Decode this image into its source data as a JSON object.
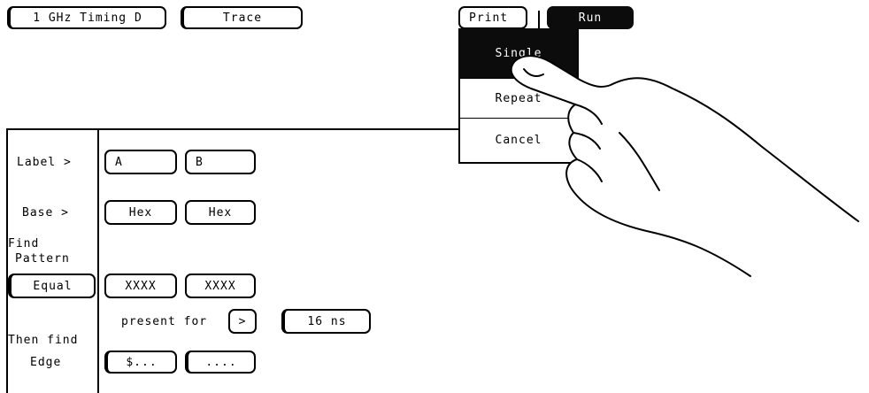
{
  "header": {
    "analyzer_menu": "1 GHz Timing D",
    "mode_menu": "Trace",
    "print_label": "Print",
    "run_label": "Run"
  },
  "run_menu": {
    "items": [
      "Single",
      "Repeat",
      "Cancel"
    ],
    "selected": "Single"
  },
  "trace": {
    "label_row": {
      "title": "Label >",
      "values": [
        "A",
        "B"
      ]
    },
    "base_row": {
      "title": "Base >",
      "values": [
        "Hex",
        "Hex"
      ]
    },
    "find_title": "Find",
    "pattern_title": "Pattern",
    "pattern_qualifier": "Equal",
    "pattern_values": [
      "XXXX",
      "XXXX"
    ],
    "present_for_label": "present for",
    "duration_operator": ">",
    "duration_value": "16 ns",
    "then_find_label": "Then find",
    "edge_label": "Edge",
    "edge_values": [
      "$...",
      "...."
    ]
  }
}
